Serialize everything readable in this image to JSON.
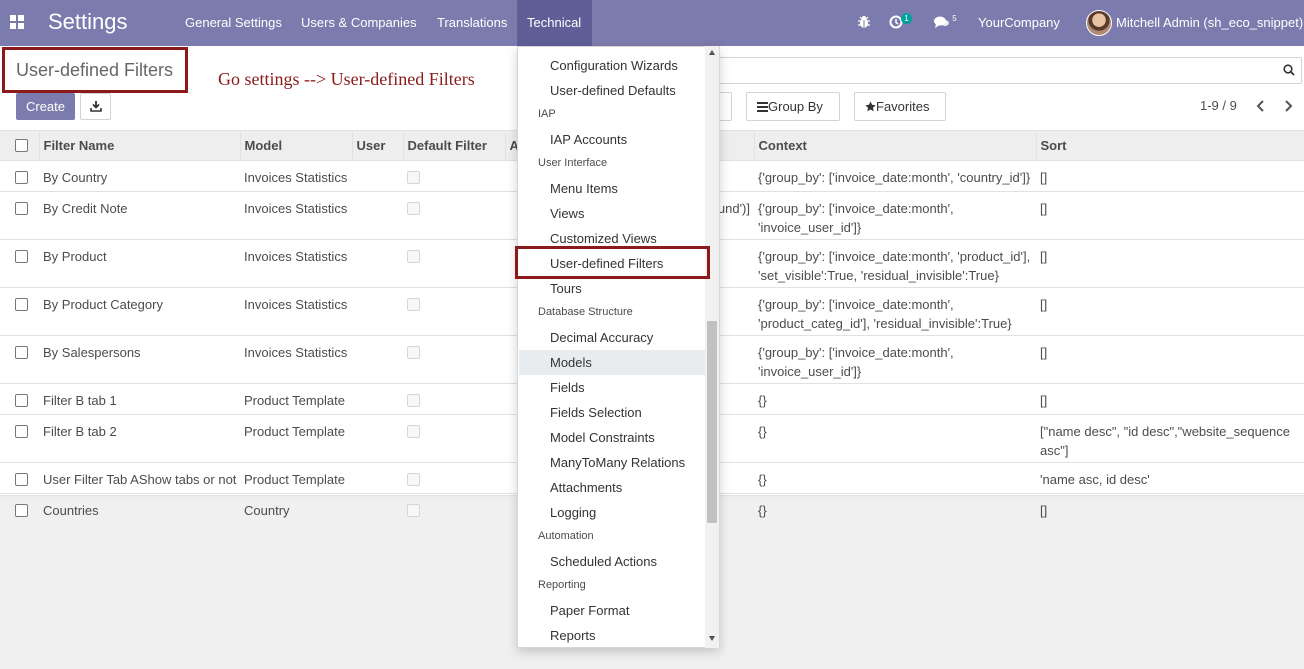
{
  "navbar": {
    "brand": "Settings",
    "menu": [
      "General Settings",
      "Users & Companies",
      "Translations",
      "Technical"
    ],
    "activity_count": "1",
    "message_count": "5",
    "company": "YourCompany",
    "user": "Mitchell Admin (sh_eco_snippet)"
  },
  "control_panel": {
    "breadcrumb": "User-defined Filters",
    "annotation": "Go settings --> User-defined Filters",
    "create_label": "Create",
    "group_by_label": "Group By",
    "favorites_label": "Favorites",
    "pager": "1-9 / 9"
  },
  "table": {
    "columns": [
      "Filter Name",
      "Model",
      "User",
      "Default Filter",
      "A",
      "Context",
      "Sort"
    ],
    "rows": [
      {
        "name": "By Country",
        "model": "Invoices Statistics",
        "context_peek": "",
        "context": "{'group_by': ['invoice_date:month', 'country_id']}",
        "sort": "[]"
      },
      {
        "name": "By Credit Note",
        "model": "Invoices Statistics",
        "context_peek": "und')]",
        "context": "{'group_by': ['invoice_date:month', 'invoice_user_id']}",
        "sort": "[]"
      },
      {
        "name": "By Product",
        "model": "Invoices Statistics",
        "context_peek": "",
        "context": "{'group_by': ['invoice_date:month', 'product_id'], 'set_visible':True, 'residual_invisible':True}",
        "sort": "[]"
      },
      {
        "name": "By Product Category",
        "model": "Invoices Statistics",
        "context_peek": "",
        "context": "{'group_by': ['invoice_date:month', 'product_categ_id'], 'residual_invisible':True}",
        "sort": "[]"
      },
      {
        "name": "By Salespersons",
        "model": "Invoices Statistics",
        "context_peek": "",
        "context": "{'group_by': ['invoice_date:month', 'invoice_user_id']}",
        "sort": "[]"
      },
      {
        "name": "Filter B tab 1",
        "model": "Product Template",
        "context_peek": "",
        "context": "{}",
        "sort": "[]"
      },
      {
        "name": "Filter B tab 2",
        "model": "Product Template",
        "context_peek": "",
        "context": "{}",
        "sort": "[\"name desc\", \"id desc\",\"website_sequence asc\"]"
      },
      {
        "name": "User Filter Tab AShow tabs or not",
        "model": "Product Template",
        "context_peek": "",
        "context": "{}",
        "sort": "'name asc, id desc'"
      },
      {
        "name": "Countries",
        "model": "Country",
        "context_peek": "",
        "context": "{}",
        "sort": "[]"
      }
    ]
  },
  "dropdown": {
    "items": [
      {
        "type": "item",
        "label": "Configuration Wizards"
      },
      {
        "type": "item",
        "label": "User-defined Defaults"
      },
      {
        "type": "header",
        "label": "IAP"
      },
      {
        "type": "item",
        "label": "IAP Accounts"
      },
      {
        "type": "header",
        "label": "User Interface"
      },
      {
        "type": "item",
        "label": "Menu Items"
      },
      {
        "type": "item",
        "label": "Views"
      },
      {
        "type": "item",
        "label": "Customized Views"
      },
      {
        "type": "item",
        "label": "User-defined Filters"
      },
      {
        "type": "item",
        "label": "Tours"
      },
      {
        "type": "header",
        "label": "Database Structure"
      },
      {
        "type": "item",
        "label": "Decimal Accuracy"
      },
      {
        "type": "item",
        "label": "Models"
      },
      {
        "type": "item",
        "label": "Fields"
      },
      {
        "type": "item",
        "label": "Fields Selection"
      },
      {
        "type": "item",
        "label": "Model Constraints"
      },
      {
        "type": "item",
        "label": "ManyToMany Relations"
      },
      {
        "type": "item",
        "label": "Attachments"
      },
      {
        "type": "item",
        "label": "Logging"
      },
      {
        "type": "header",
        "label": "Automation"
      },
      {
        "type": "item",
        "label": "Scheduled Actions"
      },
      {
        "type": "header",
        "label": "Reporting"
      },
      {
        "type": "item",
        "label": "Paper Format"
      },
      {
        "type": "item",
        "label": "Reports"
      }
    ]
  },
  "colors": {
    "navbar": "#7c7bad",
    "annotation": "#8b1a1a",
    "badge": "#00a09d"
  }
}
